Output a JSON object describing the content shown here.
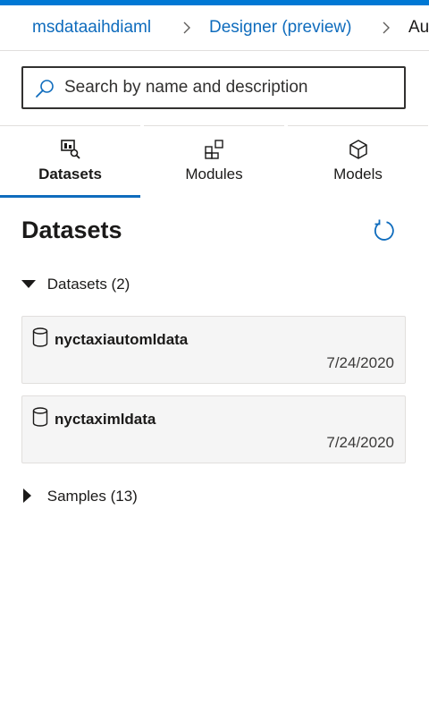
{
  "breadcrumb": {
    "items": [
      {
        "label": "msdataaihdiaml"
      },
      {
        "label": "Designer (preview)"
      },
      {
        "label": "Au"
      }
    ]
  },
  "search": {
    "placeholder": "Search by name and description",
    "value": ""
  },
  "tabs": [
    {
      "label": "Datasets",
      "icon": "dataset-search-icon",
      "active": true
    },
    {
      "label": "Modules",
      "icon": "modules-icon",
      "active": false
    },
    {
      "label": "Models",
      "icon": "cube-icon",
      "active": false
    }
  ],
  "main": {
    "title": "Datasets",
    "refresh_icon": "refresh-icon",
    "groups": [
      {
        "label": "Datasets (2)",
        "expanded": true,
        "items": [
          {
            "name": "nyctaxiautomldata",
            "date": "7/24/2020",
            "icon": "database-icon"
          },
          {
            "name": "nyctaximldata",
            "date": "7/24/2020",
            "icon": "database-icon"
          }
        ]
      },
      {
        "label": "Samples (13)",
        "expanded": false,
        "items": []
      }
    ]
  },
  "colors": {
    "accent": "#0078d4",
    "link": "#0f6cbd",
    "card_bg": "#f5f5f5",
    "text": "#1b1a19"
  }
}
